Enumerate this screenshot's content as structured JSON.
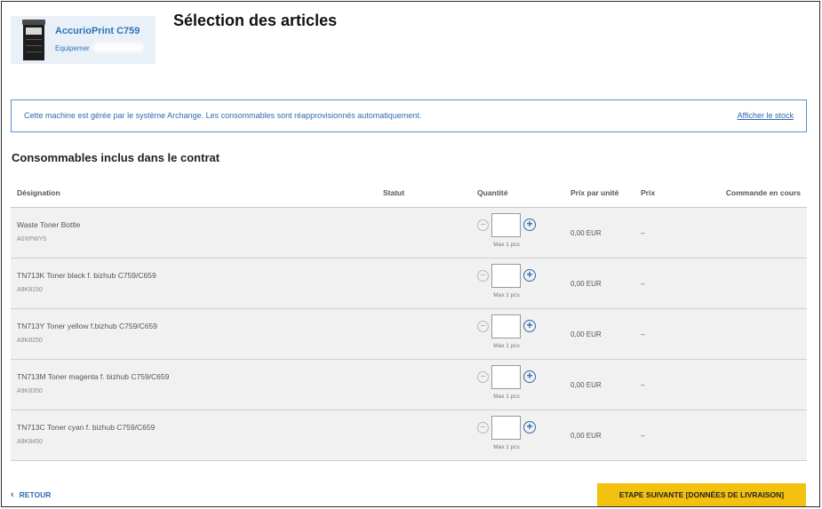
{
  "machine": {
    "name": "AccurioPrint C759",
    "subtitle": "Equipemer"
  },
  "page_title": "Sélection des articles",
  "banner": {
    "text": "Cette machine est gérée par le système Archange. Les consommables sont réapprovisionnés automatiquement.",
    "link": "Afficher le stock"
  },
  "section_title": "Consommables inclus dans le contrat",
  "table": {
    "headers": {
      "designation": "Désignation",
      "statut": "Statut",
      "quantite": "Quantité",
      "prix_unite": "Prix par unité",
      "prix": "Prix",
      "commande": "Commande en cours"
    },
    "rows": [
      {
        "name": "Waste Toner Bottle",
        "code": "A0XPWY5",
        "quantity": "",
        "max": "Max 1 pcs",
        "unit_price": "0,00 EUR",
        "price": "–"
      },
      {
        "name": "TN713K Toner black f. bizhub C759/C659",
        "code": "A9K8150",
        "quantity": "",
        "max": "Max 1 pcs",
        "unit_price": "0,00 EUR",
        "price": "–"
      },
      {
        "name": "TN713Y Toner yellow f.bizhub C759/C659",
        "code": "A9K8250",
        "quantity": "",
        "max": "Max 1 pcs",
        "unit_price": "0,00 EUR",
        "price": "–"
      },
      {
        "name": "TN713M Toner magenta f. bizhub C759/C659",
        "code": "A9K8350",
        "quantity": "",
        "max": "Max 1 pcs",
        "unit_price": "0,00 EUR",
        "price": "–"
      },
      {
        "name": "TN713C Toner cyan f. bizhub C759/C659",
        "code": "A9K8450",
        "quantity": "",
        "max": "Max 1 pcs",
        "unit_price": "0,00 EUR",
        "price": "–"
      }
    ]
  },
  "icons": {
    "minus": "−",
    "plus": "+",
    "back": "‹"
  },
  "footer": {
    "back_label": "RETOUR",
    "next_label": "ETAPE SUIVANTE [DONNÉES DE LIVRAISON]"
  },
  "colors": {
    "accent_blue": "#2e6aad",
    "button_yellow": "#f3c10f"
  }
}
